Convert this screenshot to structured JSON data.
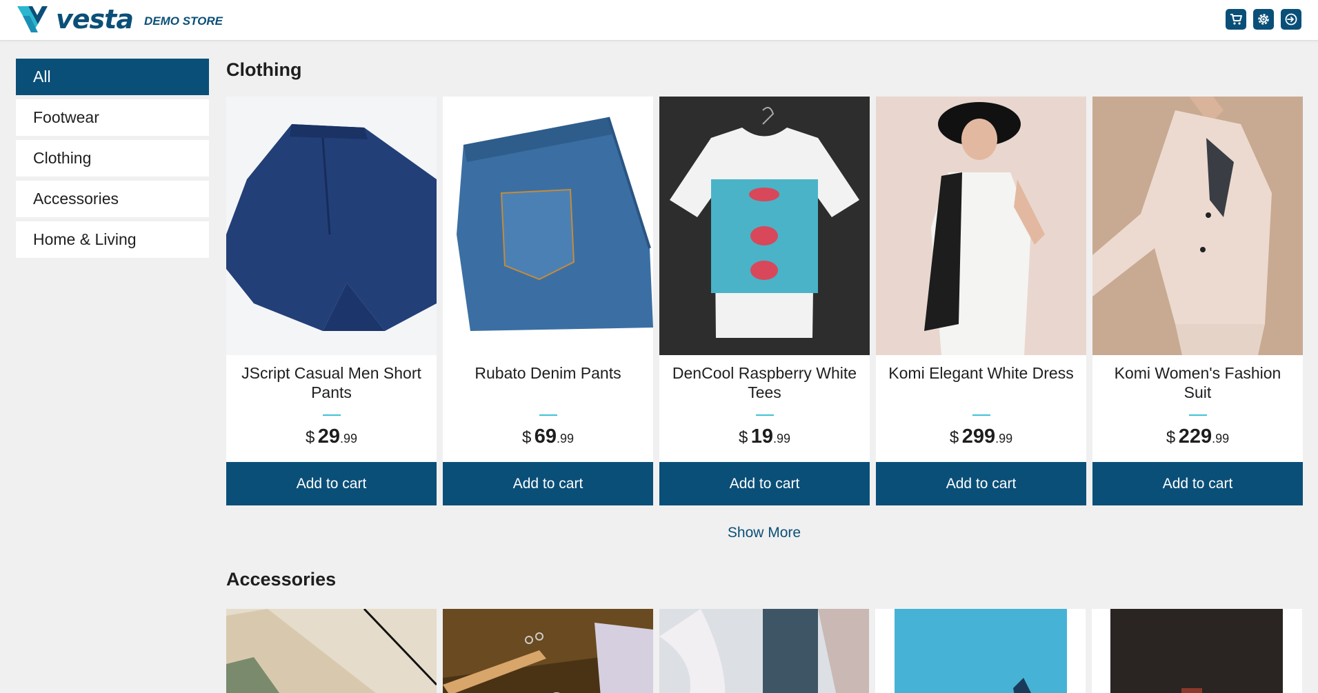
{
  "brand": {
    "name": "vesta",
    "subtitle": "DEMO STORE"
  },
  "header": {
    "icons": [
      "cart-icon",
      "gear-icon",
      "sign-in-icon"
    ]
  },
  "sidebar": {
    "items": [
      {
        "label": "All",
        "active": true
      },
      {
        "label": "Footwear",
        "active": false
      },
      {
        "label": "Clothing",
        "active": false
      },
      {
        "label": "Accessories",
        "active": false
      },
      {
        "label": "Home & Living",
        "active": false
      }
    ]
  },
  "sections": [
    {
      "title": "Clothing",
      "products": [
        {
          "name": "JScript Casual Men Short Pants",
          "currency": "$",
          "price_main": "29",
          "price_cents": ".99",
          "button": "Add to cart"
        },
        {
          "name": "Rubato Denim Pants",
          "currency": "$",
          "price_main": "69",
          "price_cents": ".99",
          "button": "Add to cart"
        },
        {
          "name": "DenCool Raspberry White Tees",
          "currency": "$",
          "price_main": "19",
          "price_cents": ".99",
          "button": "Add to cart"
        },
        {
          "name": "Komi Elegant White Dress",
          "currency": "$",
          "price_main": "299",
          "price_cents": ".99",
          "button": "Add to cart"
        },
        {
          "name": "Komi Women's Fashion Suit",
          "currency": "$",
          "price_main": "229",
          "price_cents": ".99",
          "button": "Add to cart"
        }
      ],
      "show_more": "Show More"
    },
    {
      "title": "Accessories"
    }
  ],
  "colors": {
    "primary": "#0a4f78",
    "accent": "#3fc1d6",
    "background": "#f0f0f0"
  }
}
